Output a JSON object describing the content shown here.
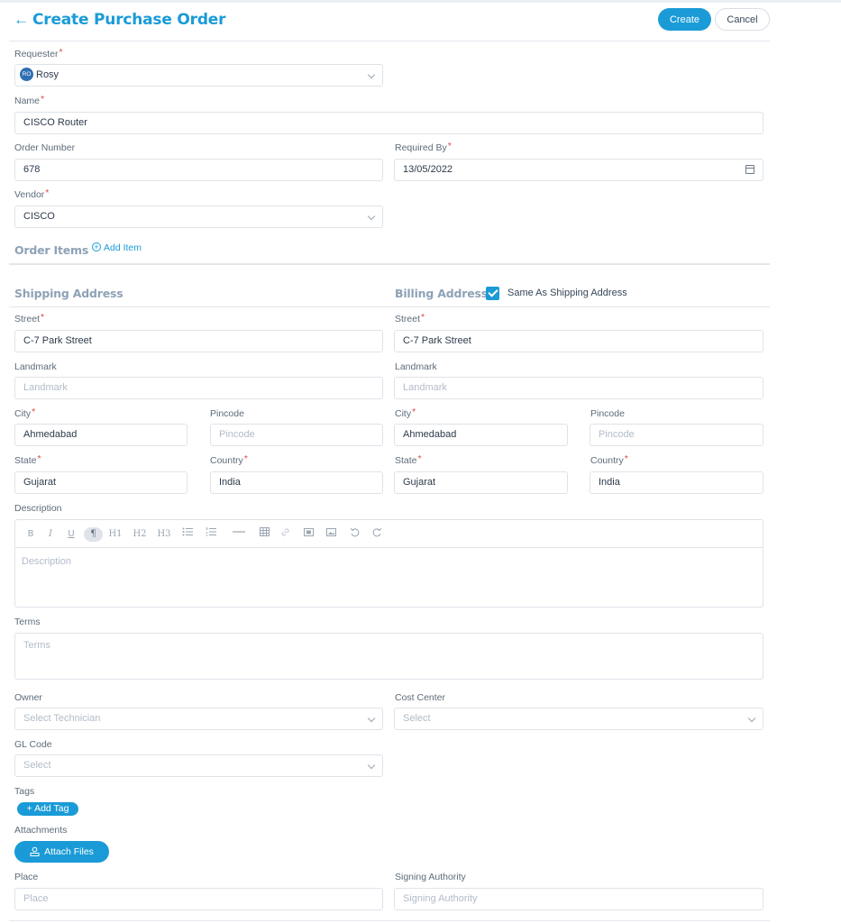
{
  "header": {
    "back_icon": "arrow-left-icon",
    "title": "Create Purchase Order",
    "create_label": "Create",
    "cancel_label": "Cancel"
  },
  "form": {
    "requester": {
      "label": "Requester",
      "avatar": "RO",
      "value": "Rosy"
    },
    "name": {
      "label": "Name",
      "value": "CISCO Router"
    },
    "order_number": {
      "label": "Order Number",
      "value": "678"
    },
    "required_by": {
      "label": "Required By",
      "value": "13/05/2022"
    },
    "vendor": {
      "label": "Vendor",
      "value": "CISCO"
    }
  },
  "order_items": {
    "title": "Order Items",
    "add_label": "Add Item"
  },
  "shipping": {
    "title": "Shipping Address",
    "street": {
      "label": "Street",
      "value": "C-7 Park Street"
    },
    "landmark": {
      "label": "Landmark",
      "placeholder": "Landmark"
    },
    "city": {
      "label": "City",
      "value": "Ahmedabad"
    },
    "pincode": {
      "label": "Pincode",
      "placeholder": "Pincode"
    },
    "state": {
      "label": "State",
      "value": "Gujarat"
    },
    "country": {
      "label": "Country",
      "value": "India"
    }
  },
  "billing": {
    "title": "Billing Address",
    "same_as_label": "Same As Shipping Address",
    "same_as_checked": true,
    "street": {
      "label": "Street",
      "value": "C-7 Park Street"
    },
    "landmark": {
      "label": "Landmark",
      "placeholder": "Landmark"
    },
    "city": {
      "label": "City",
      "value": "Ahmedabad"
    },
    "pincode": {
      "label": "Pincode",
      "placeholder": "Pincode"
    },
    "state": {
      "label": "State",
      "value": "Gujarat"
    },
    "country": {
      "label": "Country",
      "value": "India"
    }
  },
  "description": {
    "label": "Description",
    "placeholder": "Description",
    "toolbar": {
      "bold": "B",
      "italic": "I",
      "underline": "U",
      "paragraph": "¶",
      "h1": "H1",
      "h2": "H2",
      "h3": "H3"
    }
  },
  "terms": {
    "label": "Terms",
    "placeholder": "Terms"
  },
  "owner": {
    "label": "Owner",
    "placeholder": "Select Technician"
  },
  "cost_center": {
    "label": "Cost Center",
    "placeholder": "Select"
  },
  "gl_code": {
    "label": "GL Code",
    "placeholder": "Select"
  },
  "tags": {
    "label": "Tags",
    "add_label": "+ Add Tag"
  },
  "attachments": {
    "label": "Attachments",
    "button_label": "Attach Files"
  },
  "place": {
    "label": "Place",
    "placeholder": "Place"
  },
  "signing_authority": {
    "label": "Signing Authority",
    "placeholder": "Signing Authority"
  },
  "colors": {
    "accent": "#1a9bd7",
    "required": "#e04848",
    "section": "#8ea2b6"
  }
}
